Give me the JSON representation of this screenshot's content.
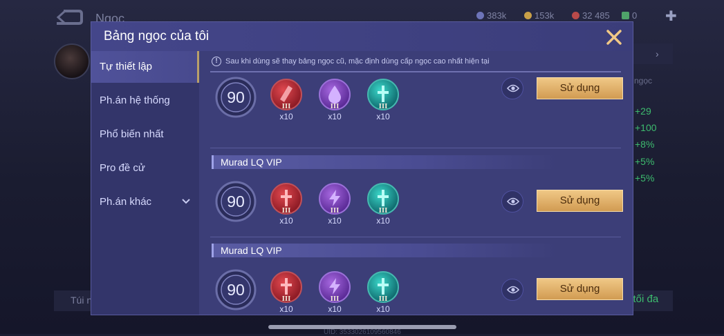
{
  "background": {
    "title": "Ngọc",
    "resources": [
      {
        "value": "383k",
        "color": "#6d74b8"
      },
      {
        "value": "153k",
        "color": "#c9a048"
      },
      {
        "value": "32 485",
        "color": "#b84a4a"
      },
      {
        "value": "0",
        "color": "#4fa26a"
      }
    ],
    "rune_label": "ngọc",
    "stats": [
      "+29",
      "+100",
      "+8%",
      "+5%",
      "+5%"
    ],
    "bottom_left_text": "Túi n",
    "bottom_right_text": "p tối đa",
    "uid_text": "UID: 3533026109560846"
  },
  "modal": {
    "title": "Bảng ngọc của tôi",
    "close_icon": "close-icon",
    "accent_color": "#f0c886",
    "notice": "Sau khi dùng sẽ thay bảng ngọc cũ, mặc định dùng cấp ngọc cao nhất hiện tại",
    "sidebar": [
      {
        "label": "Tự thiết lập",
        "active": true
      },
      {
        "label": "Ph.án hệ thống",
        "active": false
      },
      {
        "label": "Phổ biến nhất",
        "active": false
      },
      {
        "label": "Pro đề cử",
        "active": false
      },
      {
        "label": "Ph.án khác",
        "active": false,
        "has_chevron": true
      }
    ],
    "sets": [
      {
        "name": "",
        "level": "90",
        "gems": [
          {
            "color": "red",
            "icon": "blade-gem-icon",
            "tier": "III",
            "count": "x10"
          },
          {
            "color": "purple",
            "icon": "drop-gem-icon",
            "tier": "III",
            "count": "x10"
          },
          {
            "color": "teal",
            "icon": "sword-gem-icon",
            "tier": "III",
            "count": "x10"
          }
        ],
        "use_label": "Sử dụng"
      },
      {
        "name": "Murad LQ VIP",
        "level": "90",
        "gems": [
          {
            "color": "red",
            "icon": "sword-gem-icon",
            "tier": "III",
            "count": "x10"
          },
          {
            "color": "purple",
            "icon": "lightning-gem-icon",
            "tier": "III",
            "count": "x10"
          },
          {
            "color": "teal",
            "icon": "sword-gem-icon",
            "tier": "III",
            "count": "x10"
          }
        ],
        "use_label": "Sử dụng"
      },
      {
        "name": "Murad LQ VIP",
        "level": "90",
        "gems": [
          {
            "color": "red",
            "icon": "sword-gem-icon",
            "tier": "III",
            "count": "x10"
          },
          {
            "color": "purple",
            "icon": "lightning-gem-icon",
            "tier": "III",
            "count": "x10"
          },
          {
            "color": "teal",
            "icon": "sword-gem-icon",
            "tier": "III",
            "count": "x10"
          }
        ],
        "use_label": "Sử dụng"
      }
    ]
  }
}
